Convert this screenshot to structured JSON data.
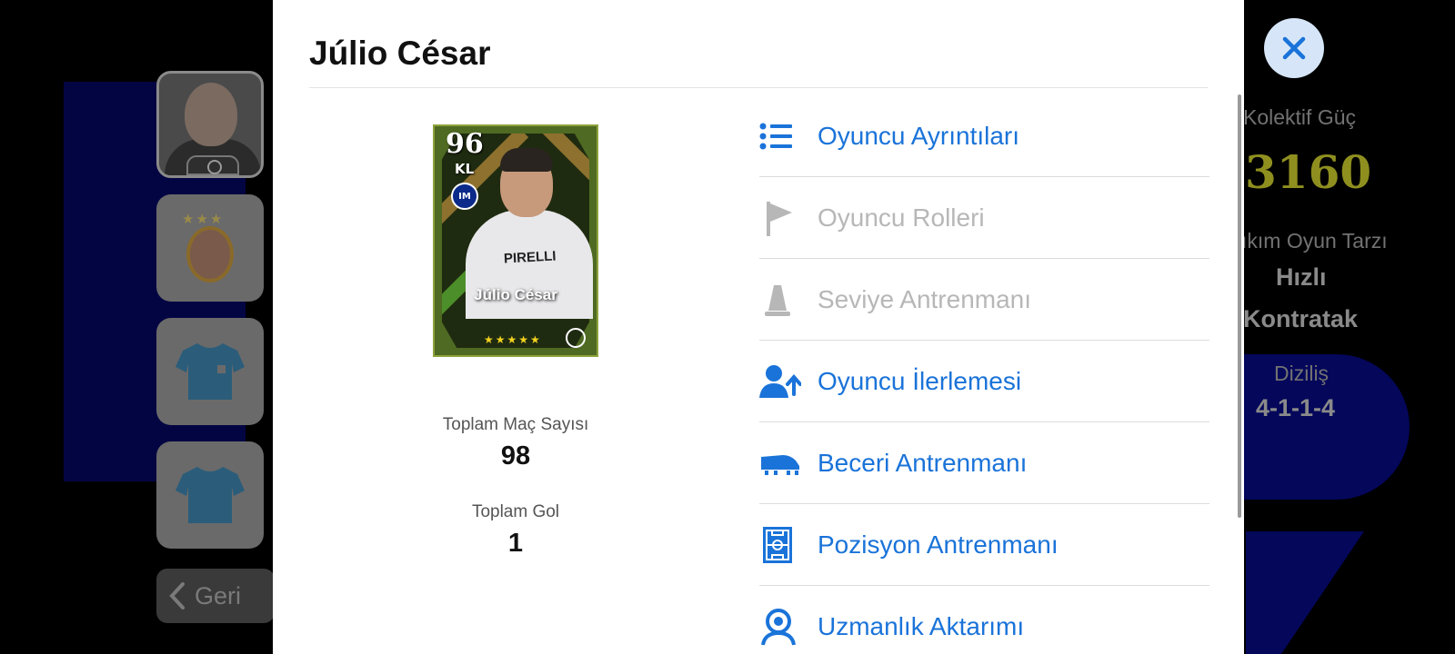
{
  "modal": {
    "title": "Júlio César",
    "card": {
      "rating": "96",
      "position": "KL",
      "name": "Júlio César",
      "sponsor": "PIRELLI",
      "stars": "★★★★★",
      "club_icon": "inter-crest-icon"
    },
    "stats": [
      {
        "label": "Toplam Maç Sayısı",
        "value": "98"
      },
      {
        "label": "Toplam Gol",
        "value": "1"
      }
    ],
    "menu": [
      {
        "label": "Oyuncu Ayrıntıları",
        "icon": "list-icon",
        "state": "active"
      },
      {
        "label": "Oyuncu Rolleri",
        "icon": "flag-icon",
        "state": "disabled"
      },
      {
        "label": "Seviye Antrenmanı",
        "icon": "cone-icon",
        "state": "disabled"
      },
      {
        "label": "Oyuncu İlerlemesi",
        "icon": "player-progress-icon",
        "state": "active"
      },
      {
        "label": "Beceri Antrenmanı",
        "icon": "boot-icon",
        "state": "active"
      },
      {
        "label": "Pozisyon Antrenmanı",
        "icon": "pitch-icon",
        "state": "active"
      },
      {
        "label": "Uzmanlık Aktarımı",
        "icon": "expert-icon",
        "state": "active"
      }
    ]
  },
  "background": {
    "back_label": "Geri",
    "team_power_label": "Kolektif Güç",
    "team_power_value": "3160",
    "playstyle_label": "ıkım Oyun Tarzı",
    "playstyle_value_line1": "Hızlı",
    "playstyle_value_line2": "Kontratak",
    "formation_label": "Diziliş",
    "formation_value": "4-1-1-4"
  },
  "colors": {
    "accent_blue": "#1a73d9",
    "disabled_gray": "#b7b7b7",
    "team_power_yellow": "#9a9a22",
    "close_bg": "#d6e6f8"
  }
}
